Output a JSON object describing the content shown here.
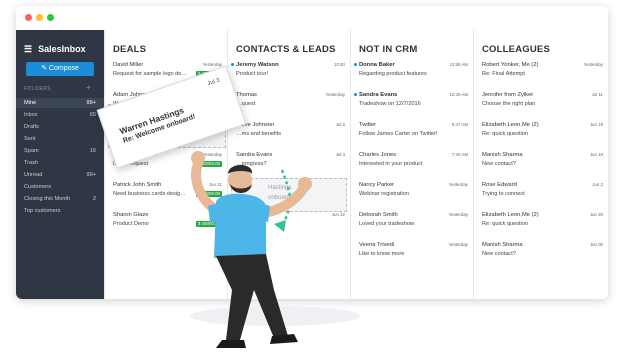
{
  "app": {
    "name": "SalesInbox",
    "compose": "Compose"
  },
  "colors": {
    "sidebar": "#2f3744",
    "accent": "#1a8cd8",
    "amount": "#28a745"
  },
  "sidebar": {
    "folders_label": "FOLDERS",
    "items": [
      {
        "label": "Mine",
        "count": "99+"
      },
      {
        "label": "Inbox",
        "count": "65"
      },
      {
        "label": "Drafts",
        "count": ""
      },
      {
        "label": "Sent",
        "count": ""
      },
      {
        "label": "Spam",
        "count": "16"
      },
      {
        "label": "Trash",
        "count": ""
      },
      {
        "label": "Unread",
        "count": "99+"
      },
      {
        "label": "Customers",
        "count": ""
      },
      {
        "label": "Closing this Month",
        "count": "2"
      },
      {
        "label": "Top customers",
        "count": ""
      }
    ]
  },
  "columns": [
    {
      "title": "DEALS",
      "cards": [
        {
          "name": "David Miller",
          "subject": "Request for sample logo de…",
          "time": "Yesterday",
          "amount": "$ 40000.00"
        },
        {
          "name": "Adam Johnson",
          "subject": "Web design deal- confirm…",
          "time": "",
          "amount": ""
        },
        {
          "name": "Velar",
          "subject": "Confirm… in pricing",
          "time": "Jul 02",
          "amount": "$ 40000.00"
        },
        {
          "name": "George Faulkner",
          "subject": "Demo request",
          "time": "Yesterday",
          "amount": "$ 40000.00"
        },
        {
          "name": "Patrick John Smith",
          "subject": "Need business cards desig…",
          "time": "Jun 21",
          "amount": "$ 40000.00"
        },
        {
          "name": "Sharon Glaze",
          "subject": "Product Demo",
          "time": "Jul 10",
          "amount": "$ 40000.00"
        }
      ]
    },
    {
      "title": "CONTACTS & LEADS",
      "cards": [
        {
          "name": "Jeremy Watson",
          "subject": "Product tour!",
          "time": "10:40",
          "unread": true
        },
        {
          "name": "Thomas",
          "subject": "…quest",
          "time": "Yesterday"
        },
        {
          "name": "Steve Johnson",
          "subject": "…ms and benefits",
          "time": "Jul 6"
        },
        {
          "name": "Sandra Evans",
          "subject": "…progress?",
          "time": "Jul 4"
        },
        {
          "name": "",
          "subject": "…n the design process",
          "time": "Jun 22"
        },
        {
          "name": "",
          "subject": "…ortfolio",
          "time": "Jun 22"
        }
      ]
    },
    {
      "title": "NOT IN CRM",
      "cards": [
        {
          "name": "Donna Baker",
          "subject": "Regarding product features",
          "time": "11:58 AM",
          "unread": true
        },
        {
          "name": "Sandra Evans",
          "subject": "Tradeshow on 12/7/2016",
          "time": "10:30 AM",
          "unread": true
        },
        {
          "name": "Twitter",
          "subject": "Follow James Carter on Twitter!",
          "time": "9:47 AM"
        },
        {
          "name": "Charles Jones",
          "subject": "Interested in your product",
          "time": "7:40 AM"
        },
        {
          "name": "Nancy Parker",
          "subject": "Webinar registration",
          "time": "Yesterday"
        },
        {
          "name": "Deborah Smith",
          "subject": "Loved your tradeshow",
          "time": "Yesterday"
        },
        {
          "name": "Veena Trivedi",
          "subject": "Like to know more",
          "time": "Yesterday"
        }
      ]
    },
    {
      "title": "COLLEAGUES",
      "cards": [
        {
          "name": "Robert Yonker, Me (2)",
          "subject": "Re: Final Attempt",
          "time": "Yesterday"
        },
        {
          "name": "Jennifer from Zylker",
          "subject": "Choose the right plan",
          "time": "Jul 11"
        },
        {
          "name": "Elizabeth Leon,Me (2)",
          "subject": "Re: quick question",
          "time": "Jun 19"
        },
        {
          "name": "Manish Sharma",
          "subject": "New contact?",
          "time": "Jun 18"
        },
        {
          "name": "Rose Edward",
          "subject": "Trying to connect",
          "time": "Jun 2"
        },
        {
          "name": "Elizabeth Leon,Me (2)",
          "subject": "Re: quick question",
          "time": "Jun 20"
        },
        {
          "name": "Manish Sharma",
          "subject": "New contact?",
          "time": "Jun 00"
        }
      ]
    }
  ],
  "dragged_card": {
    "name": "Warren Hastings",
    "subject": "Re: Welcome onboard!",
    "time": "Jul 3"
  },
  "ghost_card": {
    "name": "Hastings",
    "subject": "onboard!"
  }
}
